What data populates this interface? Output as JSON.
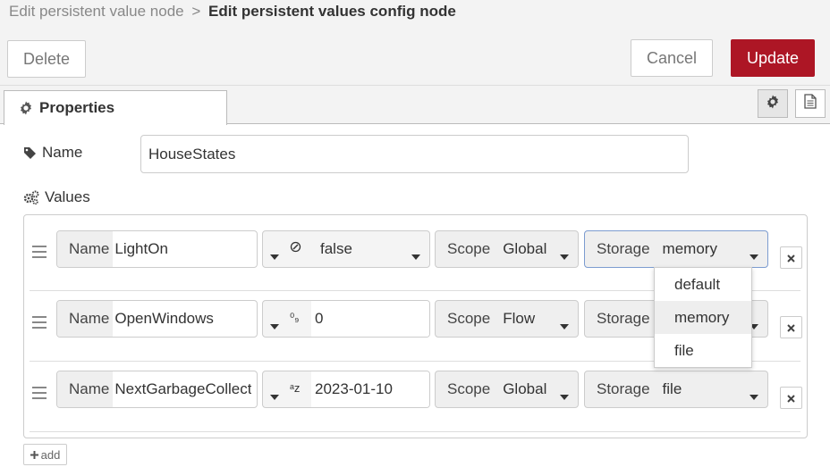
{
  "breadcrumb": {
    "previous": "Edit persistent value node",
    "separator": ">",
    "current": "Edit persistent values config node"
  },
  "toolbar": {
    "delete_label": "Delete",
    "cancel_label": "Cancel",
    "update_label": "Update"
  },
  "tabs": {
    "properties_label": "Properties"
  },
  "form": {
    "name_label": "Name",
    "name_value": "HouseStates",
    "values_label": "Values"
  },
  "values": [
    {
      "name_label": "Name",
      "name": "LightOn",
      "type_icon": "boolean-icon",
      "type_icon_text": "⊕",
      "value": "false",
      "scope_label": "Scope",
      "scope": "Global",
      "storage_label": "Storage",
      "storage": "memory"
    },
    {
      "name_label": "Name",
      "name": "OpenWindows",
      "type_icon": "number-icon",
      "type_icon_text": "⁰₉",
      "value": "0",
      "scope_label": "Scope",
      "scope": "Flow",
      "storage_label": "Storage",
      "storage": ""
    },
    {
      "name_label": "Name",
      "name": "NextGarbageCollect",
      "type_icon": "string-icon",
      "type_icon_text": "ᵃz",
      "value": "2023-01-10",
      "scope_label": "Scope",
      "scope": "Global",
      "storage_label": "Storage",
      "storage": "file"
    }
  ],
  "storage_dropdown": {
    "options": [
      "default",
      "memory",
      "file"
    ],
    "highlighted": "memory"
  },
  "add_label": "add",
  "colors": {
    "accent": "#ad1625",
    "focus": "#7c9cd0"
  }
}
